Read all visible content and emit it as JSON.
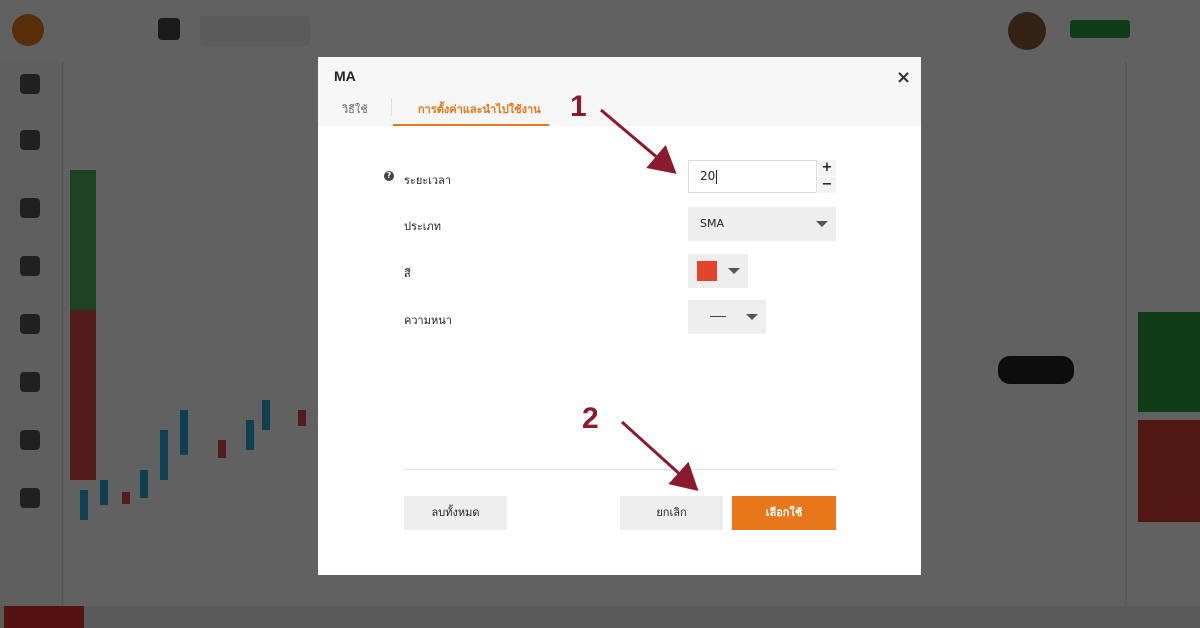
{
  "modal": {
    "title": "MA",
    "close_icon": "×",
    "tabs": [
      {
        "label": "วิธีใช้",
        "active": false
      },
      {
        "label": "การตั้งค่าและนำไปใช้งาน",
        "active": true
      }
    ],
    "help_icon": "?",
    "fields": {
      "period": {
        "label": "ระยะเวลา",
        "value": "20",
        "plus": "+",
        "minus": "−"
      },
      "type": {
        "label": "ประเภท",
        "value": "SMA"
      },
      "color": {
        "label": "สี",
        "value": "#e2452c"
      },
      "thickness": {
        "label": "ความหนา"
      }
    },
    "buttons": {
      "clear_all": "ลบทั้งหมด",
      "cancel": "ยกเลิก",
      "apply": "เลือกใช้"
    }
  },
  "annotations": {
    "step_1": "1",
    "step_2": "2",
    "arrow_color": "#8b1a2c"
  },
  "colors": {
    "accent": "#e8761a"
  }
}
